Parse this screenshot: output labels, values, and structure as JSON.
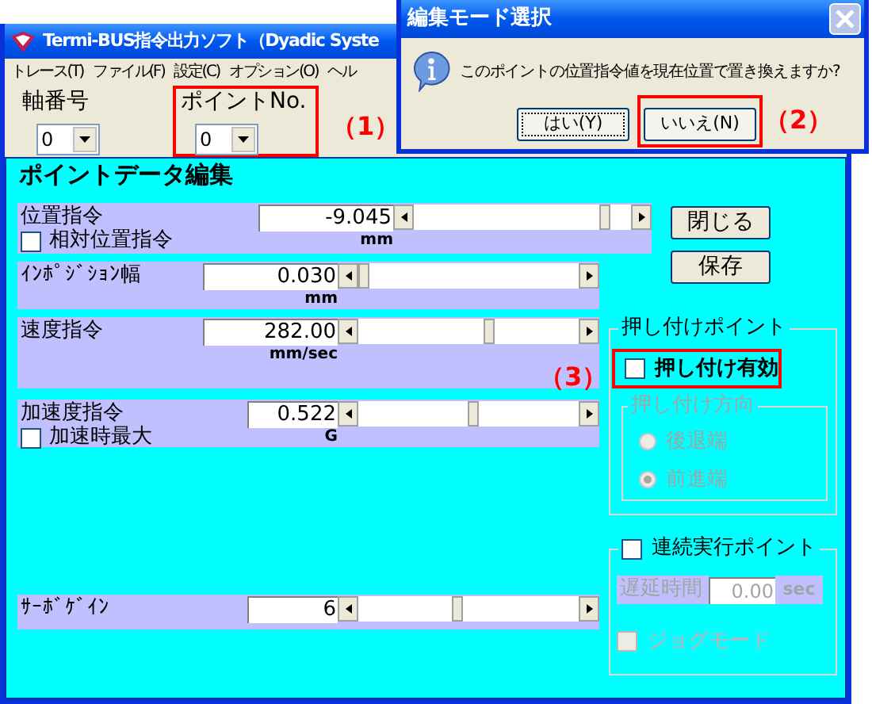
{
  "main_window": {
    "title": "Termi-BUS指令出力ソフト（Dyadic Syste"
  },
  "menu": [
    "トレース(T)",
    "ファイル(F)",
    "設定(C)",
    "オプション(O)",
    "ヘル"
  ],
  "axis_group": {
    "label": "軸番号",
    "value": "0"
  },
  "point_group": {
    "label": "ポイントNo.",
    "value": "0",
    "highlighted": true,
    "annotation": "（1）"
  },
  "editor": {
    "title": "ポイントデータ編集",
    "annotation": "（3）",
    "rows": [
      {
        "label": "位置指令",
        "value": "-9.045",
        "level": 0.9,
        "unit": "mm",
        "checkbox": {
          "label": "相対位置指令",
          "checked": false
        }
      },
      {
        "label": "ｲﾝﾎﾟｼﾞｼｮﾝ幅",
        "value": "0.030",
        "level": 0,
        "unit": "mm"
      },
      {
        "label": "速度指令",
        "value": "282.00",
        "level": 0.6,
        "unit": "mm/sec"
      },
      {
        "label": "加速度指令",
        "value": "0.522",
        "level": 0.52,
        "unit": "G",
        "checkbox": {
          "label": "加速時最大",
          "checked": false
        }
      },
      {
        "label": "ｻｰﾎﾞｹﾞｲﾝ",
        "value": "6",
        "level": 0.45
      }
    ]
  },
  "buttons": [
    "閉じる",
    "保存"
  ],
  "push_point": {
    "title": "押し付けポイント",
    "enable": {
      "label": "押し付け有効",
      "checked": false,
      "highlighted": true
    },
    "direction": {
      "title": "押し付け方向",
      "disabled": true,
      "options": [
        {
          "label": "後退端",
          "selected": false
        },
        {
          "label": "前進端",
          "selected": true
        }
      ]
    }
  },
  "continuous": {
    "checkbox": {
      "label": "連続実行ポイント",
      "checked": false
    },
    "delay": {
      "label": "遅延時間",
      "value": "0.00",
      "unit": "sec",
      "disabled": true
    },
    "jog": {
      "label": "ジョグモード",
      "checked": false,
      "disabled": true
    }
  },
  "dialog": {
    "title": "編集モード選択",
    "message": "このポイントの位置指令値を現在位置で置き換えますか?",
    "annotation": "（2）",
    "buttons": [
      {
        "label": "はい(Y)",
        "highlighted": false
      },
      {
        "label": "いいえ(N)",
        "highlighted": true
      }
    ]
  }
}
